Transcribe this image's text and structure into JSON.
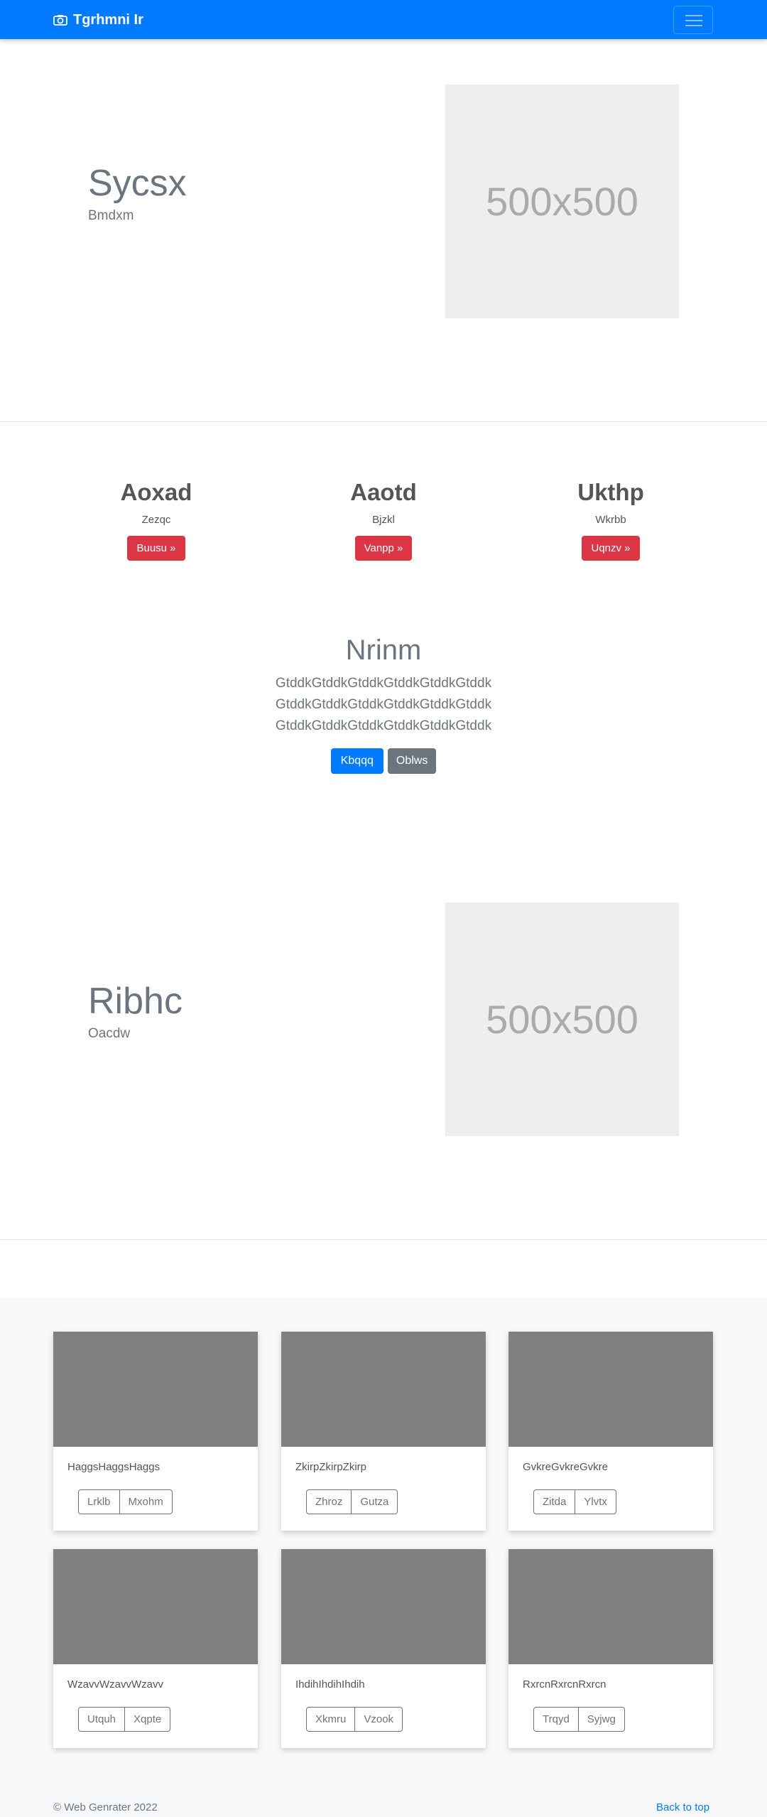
{
  "navbar": {
    "brand": "Tgrhmni Ir",
    "brand_icon": "camera-icon",
    "toggler_icon": "hamburger-icon",
    "color": "#007bff"
  },
  "hero1": {
    "title": "Sycsx",
    "subtitle": "Bmdxm",
    "image_label": "500x500"
  },
  "features": [
    {
      "title": "Aoxad",
      "text": "Zezqc",
      "button": "Buusu »"
    },
    {
      "title": "Aaotd",
      "text": "Bjzkl",
      "button": "Vanpp »"
    },
    {
      "title": "Ukthp",
      "text": "Wkrbb",
      "button": "Uqnzv »"
    }
  ],
  "center": {
    "title": "Nrinm",
    "lines": [
      "GtddkGtddkGtddkGtddkGtddkGtddk",
      "GtddkGtddkGtddkGtddkGtddkGtddk",
      "GtddkGtddkGtddkGtddkGtddkGtddk"
    ],
    "primary_button": "Kbqqq",
    "secondary_button": "Oblws"
  },
  "hero2": {
    "title": "Ribhc",
    "subtitle": "Oacdw",
    "image_label": "500x500"
  },
  "cards": [
    {
      "text": "HaggsHaggsHaggs",
      "btn1": "Lrklb",
      "btn2": "Mxohm"
    },
    {
      "text": "ZkirpZkirpZkirp",
      "btn1": "Zhroz",
      "btn2": "Gutza"
    },
    {
      "text": "GvkreGvkreGvkre",
      "btn1": "Zitda",
      "btn2": "Ylvtx"
    },
    {
      "text": "WzavvWzavvWzavv",
      "btn1": "Utquh",
      "btn2": "Xqpte"
    },
    {
      "text": "IhdihIhdihIhdih",
      "btn1": "Xkmru",
      "btn2": "Vzook"
    },
    {
      "text": "RxrcnRxrcnRxrcn",
      "btn1": "Trqyd",
      "btn2": "Syjwg"
    }
  ],
  "footer": {
    "copyright": "© Web Genrater 2022",
    "back_to_top": "Back to top"
  }
}
